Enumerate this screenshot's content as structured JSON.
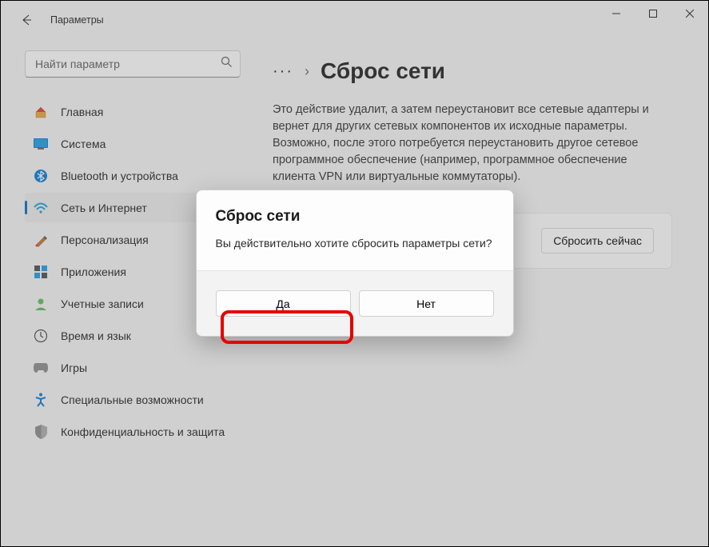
{
  "window": {
    "title": "Параметры"
  },
  "search": {
    "placeholder": "Найти параметр"
  },
  "sidebar": {
    "items": [
      {
        "label": "Главная"
      },
      {
        "label": "Система"
      },
      {
        "label": "Bluetooth и устройства"
      },
      {
        "label": "Сеть и Интернет"
      },
      {
        "label": "Персонализация"
      },
      {
        "label": "Приложения"
      },
      {
        "label": "Учетные записи"
      },
      {
        "label": "Время и язык"
      },
      {
        "label": "Игры"
      },
      {
        "label": "Специальные возможности"
      },
      {
        "label": "Конфиденциальность и защита"
      }
    ]
  },
  "breadcrumb": {
    "dots": "···",
    "sep": "›",
    "title": "Сброс сети"
  },
  "main": {
    "description": "Это действие удалит, а затем переустановит все сетевые адаптеры и вернет для других сетевых компонентов их исходные параметры. Возможно, после этого потребуется переустановить другое сетевое программное обеспечение (например, программное обеспечение клиента VPN или виртуальные коммутаторы).",
    "reset_now": "Сбросить сейчас"
  },
  "dialog": {
    "title": "Сброс сети",
    "message": "Вы действительно хотите сбросить параметры сети?",
    "yes": "Да",
    "no": "Нет"
  }
}
